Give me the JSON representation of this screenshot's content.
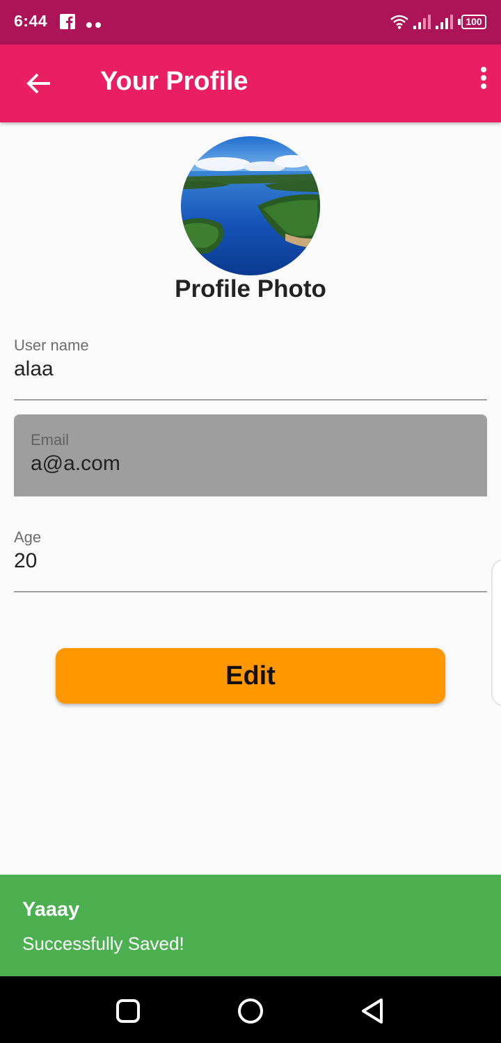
{
  "status_bar": {
    "time": "6:44",
    "battery": "100",
    "icons": [
      "facebook-icon",
      "notification-dots-icon",
      "wifi-icon",
      "signal-icon",
      "signal-icon",
      "battery-icon"
    ]
  },
  "app_bar": {
    "title": "Your Profile",
    "back_icon": "arrow-back-icon",
    "menu_icon": "more-vert-icon"
  },
  "profile": {
    "photo_label": "Profile Photo"
  },
  "fields": {
    "username": {
      "label": "User name",
      "value": "alaa"
    },
    "email": {
      "label": "Email",
      "value": "a@a.com"
    },
    "age": {
      "label": "Age",
      "value": "20"
    }
  },
  "actions": {
    "edit_label": "Edit"
  },
  "snackbar": {
    "title": "Yaaay",
    "message": "Successfully Saved!"
  },
  "nav_bar": {
    "icons": [
      "square-icon",
      "circle-icon",
      "triangle-back-icon"
    ]
  },
  "colors": {
    "status_bar": "#ad1457",
    "app_bar": "#e91e63",
    "button": "#ff9800",
    "snackbar": "#4caf50",
    "disabled_field": "#9e9e9e"
  }
}
